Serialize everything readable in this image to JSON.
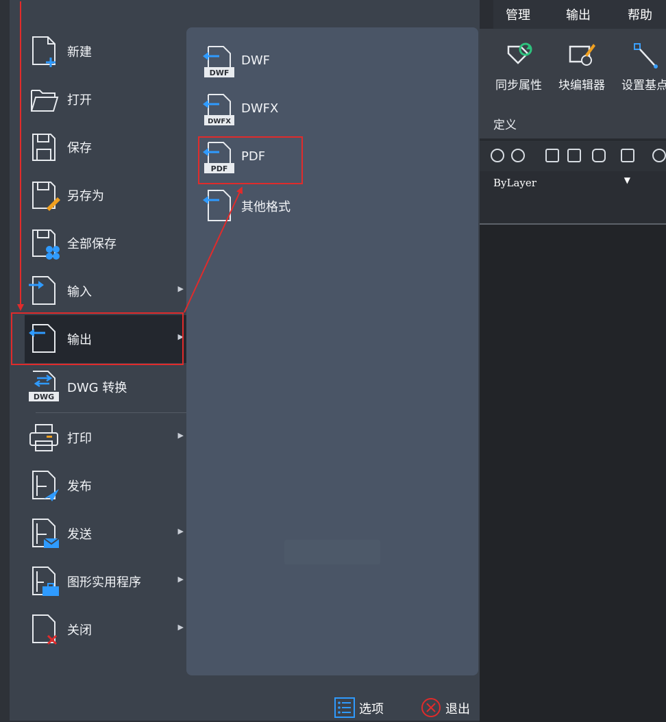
{
  "ribbon": {
    "tabs": [
      "管理",
      "输出",
      "帮助"
    ],
    "buttons": [
      {
        "label": "同步属性",
        "icon": "sync-attributes-icon"
      },
      {
        "label": "块编辑器",
        "icon": "block-editor-icon"
      },
      {
        "label": "设置基点",
        "icon": "set-basepoint-icon"
      }
    ],
    "group_label": "定义"
  },
  "layer_row": {
    "value": "ByLayer"
  },
  "app_menu": {
    "items": [
      {
        "label": "新建",
        "icon": "new-file-icon",
        "has_submenu": false
      },
      {
        "label": "打开",
        "icon": "open-folder-icon",
        "has_submenu": false
      },
      {
        "label": "保存",
        "icon": "save-icon",
        "has_submenu": false
      },
      {
        "label": "另存为",
        "icon": "save-as-icon",
        "has_submenu": false
      },
      {
        "label": "全部保存",
        "icon": "save-all-icon",
        "has_submenu": false
      },
      {
        "label": "输入",
        "icon": "import-icon",
        "has_submenu": true
      },
      {
        "label": "输出",
        "icon": "export-icon",
        "has_submenu": true,
        "selected": true
      },
      {
        "label": "DWG 转换",
        "icon": "dwg-convert-icon",
        "has_submenu": false
      },
      {
        "label": "打印",
        "icon": "print-icon",
        "has_submenu": true
      },
      {
        "label": "发布",
        "icon": "publish-icon",
        "has_submenu": false
      },
      {
        "label": "发送",
        "icon": "send-icon",
        "has_submenu": true
      },
      {
        "label": "图形实用程序",
        "icon": "drawing-utilities-icon",
        "has_submenu": true
      },
      {
        "label": "关闭",
        "icon": "close-file-icon",
        "has_submenu": true
      }
    ]
  },
  "export_submenu": {
    "items": [
      {
        "label": "DWF",
        "badge": "DWF",
        "icon": "export-dwf-icon"
      },
      {
        "label": "DWFX",
        "badge": "DWFX",
        "icon": "export-dwfx-icon"
      },
      {
        "label": "PDF",
        "badge": "PDF",
        "icon": "export-pdf-icon",
        "highlighted": true
      },
      {
        "label": "其他格式",
        "icon": "export-other-icon"
      }
    ]
  },
  "bottom_buttons": {
    "options_label": "选项",
    "exit_label": "退出"
  },
  "colors": {
    "menu_bg": "#3b424c",
    "submenu_bg": "#4a5566",
    "selected_bg": "#23272e",
    "annotation_red": "#e12b2b",
    "icon_blue": "#1e90ff"
  }
}
